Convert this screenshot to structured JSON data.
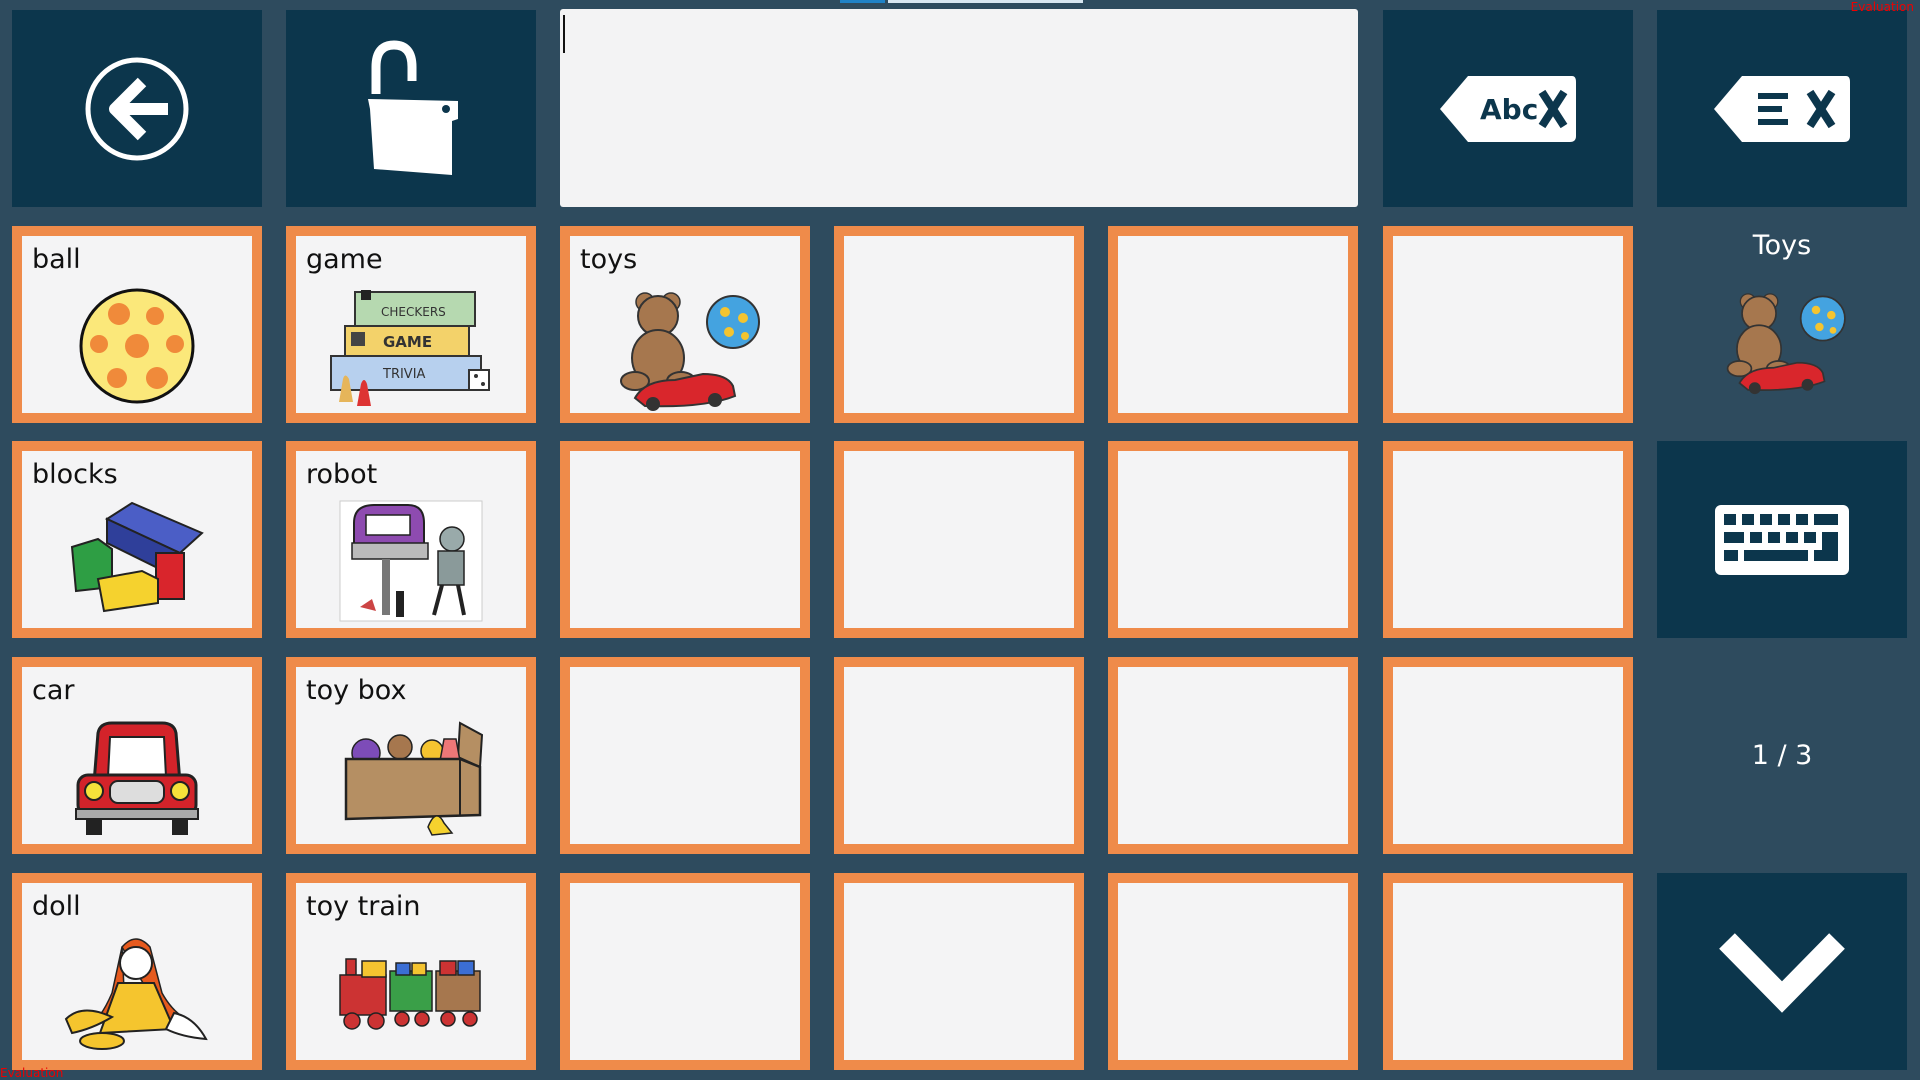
{
  "header": {
    "back_icon": "back-arrow-icon",
    "lock_icon": "unlock-icon",
    "message_text": "",
    "clear_word_label": "Abc",
    "clear_all_icon": "clear-all-icon"
  },
  "grid": {
    "cells": [
      {
        "label": "ball",
        "icon": "ball-icon"
      },
      {
        "label": "game",
        "icon": "board-games-icon",
        "icon_text": [
          "CHECKERS",
          "GAME",
          "TRIVIA"
        ]
      },
      {
        "label": "toys",
        "icon": "toys-icon"
      },
      {
        "label": ""
      },
      {
        "label": ""
      },
      {
        "label": ""
      },
      {
        "label": "blocks",
        "icon": "blocks-icon"
      },
      {
        "label": "robot",
        "icon": "robot-icon"
      },
      {
        "label": ""
      },
      {
        "label": ""
      },
      {
        "label": ""
      },
      {
        "label": ""
      },
      {
        "label": "car",
        "icon": "car-icon"
      },
      {
        "label": "toy box",
        "icon": "toy-box-icon"
      },
      {
        "label": ""
      },
      {
        "label": ""
      },
      {
        "label": ""
      },
      {
        "label": ""
      },
      {
        "label": "doll",
        "icon": "doll-icon"
      },
      {
        "label": "toy train",
        "icon": "toy-train-icon"
      },
      {
        "label": ""
      },
      {
        "label": ""
      },
      {
        "label": ""
      },
      {
        "label": ""
      }
    ]
  },
  "sidebar": {
    "category_label": "Toys",
    "category_icon": "toys-icon",
    "keyboard_icon": "keyboard-icon",
    "page_indicator": "1 / 3",
    "next_page_icon": "chevron-down-icon"
  },
  "watermark": {
    "top": "Evaluation",
    "bottom": "Evaluation"
  },
  "colors": {
    "background": "#2e4b5e",
    "button": "#0c364c",
    "cell_border": "#ef8b4a",
    "cell_fill": "#f4f4f5"
  }
}
